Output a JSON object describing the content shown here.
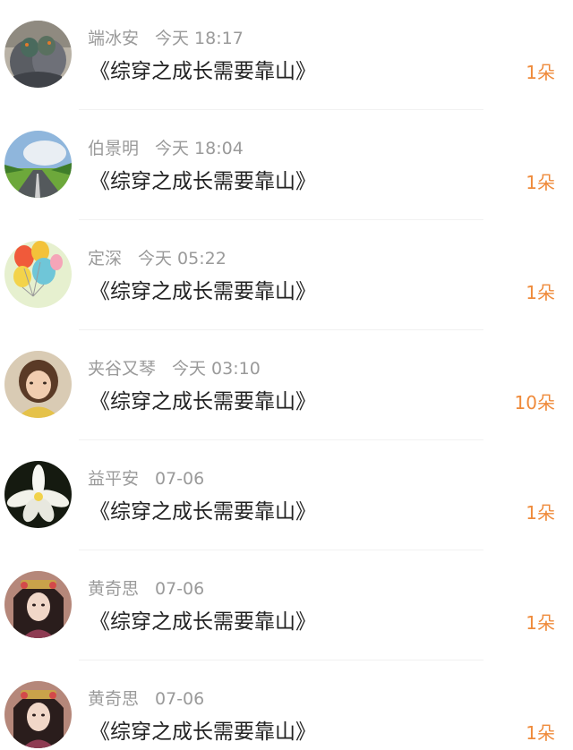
{
  "items": [
    {
      "user": "端冰安",
      "time": "今天 18:17",
      "title": "《综穿之成长需要靠山》",
      "gift": "1朵",
      "avatar_icon": "pigeons-photo-avatar"
    },
    {
      "user": "伯景明",
      "time": "今天 18:04",
      "title": "《综穿之成长需要靠山》",
      "gift": "1朵",
      "avatar_icon": "road-landscape-avatar"
    },
    {
      "user": "定深",
      "time": "今天 05:22",
      "title": "《综穿之成长需要靠山》",
      "gift": "1朵",
      "avatar_icon": "balloons-avatar"
    },
    {
      "user": "夹谷又琴",
      "time": "今天 03:10",
      "title": "《综穿之成长需要靠山》",
      "gift": "10朵",
      "avatar_icon": "child-photo-avatar"
    },
    {
      "user": "益平安",
      "time": "07-06",
      "title": "《综穿之成长需要靠山》",
      "gift": "1朵",
      "avatar_icon": "white-flower-avatar"
    },
    {
      "user": "黄奇思",
      "time": "07-06",
      "title": "《综穿之成长需要靠山》",
      "gift": "1朵",
      "avatar_icon": "costume-girl-avatar"
    },
    {
      "user": "黄奇思",
      "time": "07-06",
      "title": "《综穿之成长需要靠山》",
      "gift": "1朵",
      "avatar_icon": "costume-girl-avatar"
    }
  ],
  "colors": {
    "gift": "#ef8a3a",
    "meta": "#9a9a9a",
    "title": "#222222"
  }
}
